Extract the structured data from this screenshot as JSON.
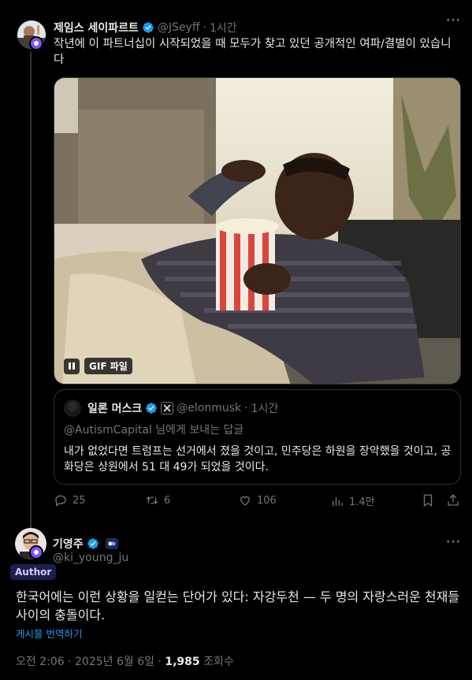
{
  "original_tweet": {
    "author_name": "제임스 세이파르트",
    "author_handle": "@JSeyff",
    "separator": "·",
    "time": "1시간",
    "text": "작년에 이 파트너십이 시작되었을 때 모두가 찾고 있던 공개적인 여파/결별이 있습니다",
    "media_label": "GIF 파일",
    "media_icon": "pause-icon",
    "quote": {
      "author_name": "일론 머스크",
      "author_handle": "@elonmusk",
      "separator": "·",
      "time": "1시간",
      "reply_to": "@AutismCapital 님에게 보내는 답글",
      "text": "내가 없었다면 트럼프는 선거에서 졌을 것이고, 민주당은 하원을 장악했을 것이고, 공화당은 상원에서 51 대 49가 되었을 것이다."
    },
    "actions": {
      "reply_count": "25",
      "retweet_count": "6",
      "like_count": "106",
      "view_count": "1.4만"
    }
  },
  "main_tweet": {
    "author_name": "기영주",
    "author_handle": "@ki_young_ju",
    "author_badge": "Author",
    "text": "한국어에는 이런 상황을 일컫는 단어가 있다: 자강두천 — 두 명의 자랑스러운 천재들 사이의 충돌이다.",
    "translate_label": "게시물 번역하기",
    "timestamp": "오전 2:06 · 2025년 6월 6일 · ",
    "views": "1,985",
    "views_label": " 조회수"
  },
  "colors": {
    "background": "#000000",
    "text_primary": "#e7e9ea",
    "text_secondary": "#71767b",
    "accent_blue": "#1d9bf0",
    "verified_blue": "#1d9bf0",
    "author_badge_bg": "#1d1f52",
    "border": "#2f3336"
  }
}
